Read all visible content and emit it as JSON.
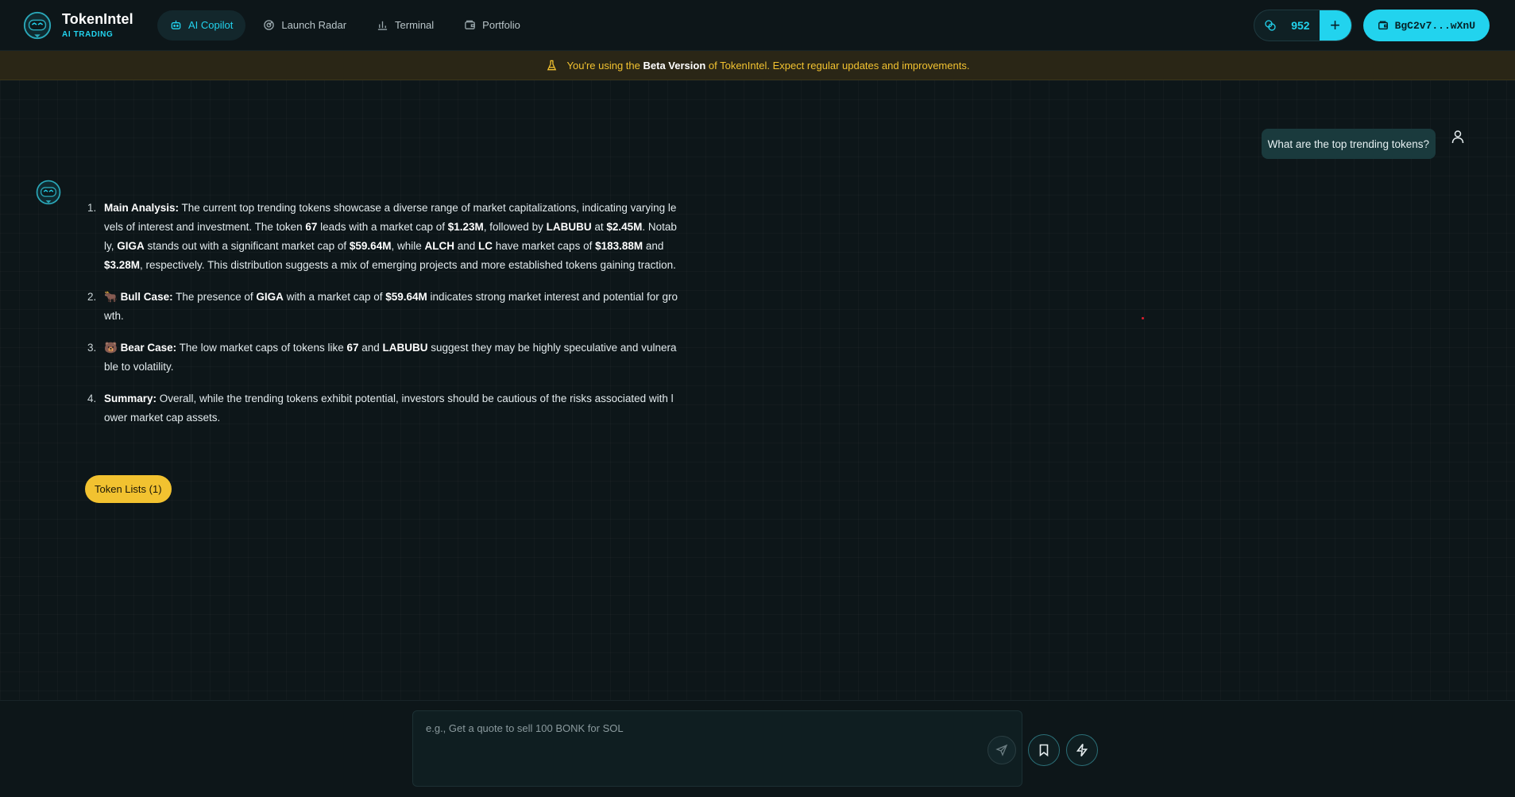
{
  "brand": {
    "name": "TokenIntel",
    "subtitle": "AI TRADING"
  },
  "nav": {
    "items": [
      {
        "label": "AI Copilot",
        "icon": "robot-icon",
        "active": true
      },
      {
        "label": "Launch Radar",
        "icon": "radar-icon",
        "active": false
      },
      {
        "label": "Terminal",
        "icon": "bar-chart-icon",
        "active": false
      },
      {
        "label": "Portfolio",
        "icon": "wallet-icon",
        "active": false
      }
    ]
  },
  "credits": {
    "count": "952",
    "add_label": "+"
  },
  "wallet": {
    "address": "BgC2v7...wXnU"
  },
  "banner": {
    "prefix": "You're using the ",
    "highlight": "Beta Version",
    "suffix": " of TokenIntel. Expect regular updates and improvements."
  },
  "chat": {
    "user_message": "What are the top trending tokens?",
    "bot_items": [
      {
        "number": "1.",
        "parts": [
          {
            "b": "Main Analysis:"
          },
          {
            "t": " The current top trending tokens showcase a diverse range of market capitalizations, indicating varying levels of interest and investment. The token "
          },
          {
            "b": "67"
          },
          {
            "t": " leads with a market cap of "
          },
          {
            "b": "$1.23M"
          },
          {
            "t": ", followed by "
          },
          {
            "b": "LABUBU"
          },
          {
            "t": " at "
          },
          {
            "b": "$2.45M"
          },
          {
            "t": ". Notably, "
          },
          {
            "b": "GIGA"
          },
          {
            "t": " stands out with a significant market cap of "
          },
          {
            "b": "$59.64M"
          },
          {
            "t": ", while "
          },
          {
            "b": "ALCH"
          },
          {
            "t": " and "
          },
          {
            "b": "LC"
          },
          {
            "t": " have market caps of "
          },
          {
            "b": "$183.88M"
          },
          {
            "t": " and "
          },
          {
            "b": "$3.28M"
          },
          {
            "t": ", respectively. This distribution suggests a mix of emerging projects and more established tokens gaining traction."
          }
        ]
      },
      {
        "number": "2.",
        "parts": [
          {
            "t": "🐂 "
          },
          {
            "b": "Bull Case:"
          },
          {
            "t": " The presence of "
          },
          {
            "b": "GIGA"
          },
          {
            "t": " with a market cap of "
          },
          {
            "b": "$59.64M"
          },
          {
            "t": " indicates strong market interest and potential for growth."
          }
        ]
      },
      {
        "number": "3.",
        "parts": [
          {
            "t": "🐻 "
          },
          {
            "b": "Bear Case:"
          },
          {
            "t": " The low market caps of tokens like "
          },
          {
            "b": "67"
          },
          {
            "t": " and "
          },
          {
            "b": "LABUBU"
          },
          {
            "t": " suggest they may be highly speculative and vulnerable to volatility."
          }
        ]
      },
      {
        "number": "4.",
        "parts": [
          {
            "b": "Summary:"
          },
          {
            "t": " Overall, while the trending tokens exhibit potential, investors should be cautious of the risks associated with lower market cap assets."
          }
        ]
      }
    ],
    "token_lists_label": "Token Lists (1)"
  },
  "composer": {
    "placeholder": "e.g., Get a quote to sell 100 BONK for SOL"
  },
  "colors": {
    "accent": "#22d3ee",
    "warning": "#f2c230",
    "background": "#0d1619"
  }
}
